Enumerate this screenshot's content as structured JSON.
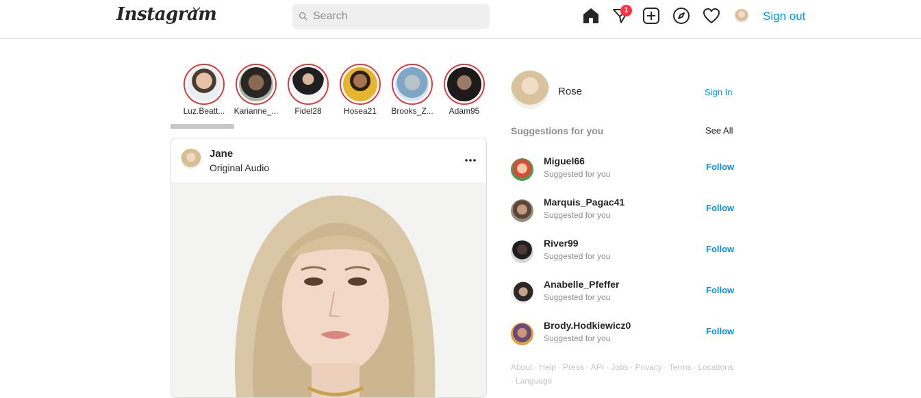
{
  "header": {
    "logo": "Instagram",
    "search_placeholder": "Search",
    "notification_count": "1",
    "sign_out": "Sign out"
  },
  "stories": [
    {
      "name": "Luz.Beatt...",
      "color": "#c9b59b"
    },
    {
      "name": "Karianne_...",
      "color": "#3d3b38"
    },
    {
      "name": "Fidel28",
      "color": "#6f5a4d"
    },
    {
      "name": "Hosea21",
      "color": "#e4b42a"
    },
    {
      "name": "Brooks_Z...",
      "color": "#8fb4d1"
    },
    {
      "name": "Adam95",
      "color": "#2f2b2a"
    }
  ],
  "post": {
    "username": "Jane",
    "audio": "Original Audio"
  },
  "sidebar": {
    "me_name": "Rose",
    "sign_in": "Sign In",
    "suggestions_title": "Suggestions for you",
    "see_all": "See All",
    "suggestions": [
      {
        "name": "Miguel66",
        "subtitle": "Suggested for you",
        "follow": "Follow",
        "color": "#d94a3a"
      },
      {
        "name": "Marquis_Pagac41",
        "subtitle": "Suggested for you",
        "follow": "Follow",
        "color": "#7a6a5a"
      },
      {
        "name": "River99",
        "subtitle": "Suggested for you",
        "follow": "Follow",
        "color": "#2b2b2b"
      },
      {
        "name": "Anabelle_Pfeffer",
        "subtitle": "Suggested for you",
        "follow": "Follow",
        "color": "#5b5552"
      },
      {
        "name": "Brody.Hodkiewicz0",
        "subtitle": "Suggested for you",
        "follow": "Follow",
        "color": "#6a4a7a"
      }
    ]
  },
  "footer": {
    "links": [
      "About",
      "Help",
      "Press",
      "API",
      "Jobs",
      "Privacy",
      "Terms",
      "Locations",
      "Language"
    ]
  },
  "colors": {
    "accent": "#0095f6",
    "story_ring": "#e2393b",
    "badge": "#ff3040"
  }
}
